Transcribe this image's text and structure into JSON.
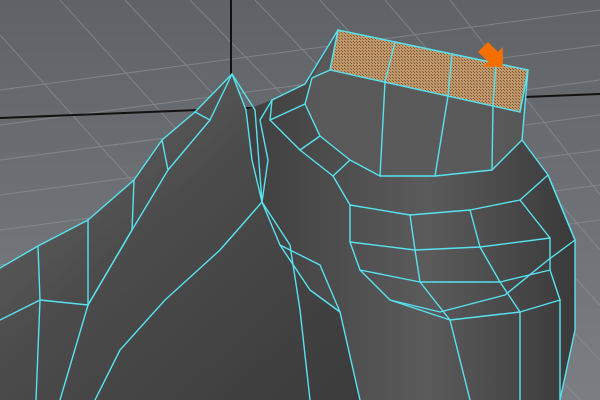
{
  "app": {
    "title": ""
  },
  "viewport": {
    "mode": "3d-modeling-viewport",
    "background": {
      "top": "#5f6266",
      "bottom": "#7b7e82"
    },
    "wire_color": "#58e2f0",
    "grid_color": "#8f9295",
    "grid_major_color": "#111111",
    "mesh_base_color": "#4f4f4f",
    "selected_face_color": "#c79a6b",
    "arrow_color": "#f46f00"
  },
  "icons": {
    "pointer_arrow": "arrow-pointer-icon"
  },
  "selection": {
    "selected_face_count": 1,
    "selected_face_label": ""
  }
}
